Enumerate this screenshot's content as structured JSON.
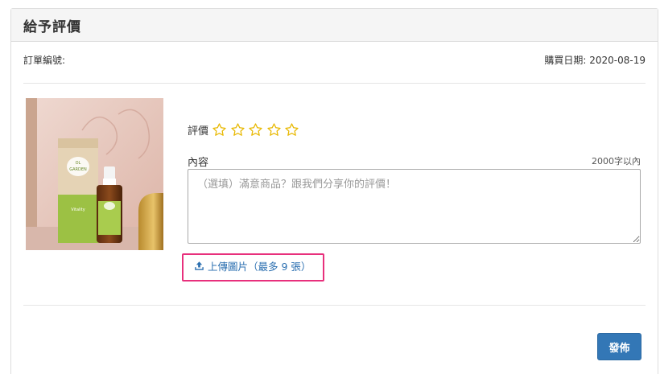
{
  "panel": {
    "title": "給予評價"
  },
  "order": {
    "number_label": "訂單編號:",
    "purchase_date_label": "購買日期: 2020-08-19"
  },
  "product": {
    "brand_top": "OL",
    "brand_name": "GARDEN",
    "product_name": "Vitality"
  },
  "rating": {
    "label": "評價",
    "stars": [
      "star-1",
      "star-2",
      "star-3",
      "star-4",
      "star-5"
    ],
    "value": 0,
    "max": 5,
    "star_color": "#e8b800"
  },
  "content": {
    "label": "內容",
    "limit": "2000字以內",
    "placeholder": "（選填）滿意商品？跟我們分享你的評價！",
    "value": ""
  },
  "upload": {
    "label": "上傳圖片（最多 9 張）",
    "highlight_color": "#e8307c",
    "link_color": "#2b6fb0"
  },
  "actions": {
    "publish_label": "發佈",
    "publish_color": "#3377b6"
  }
}
